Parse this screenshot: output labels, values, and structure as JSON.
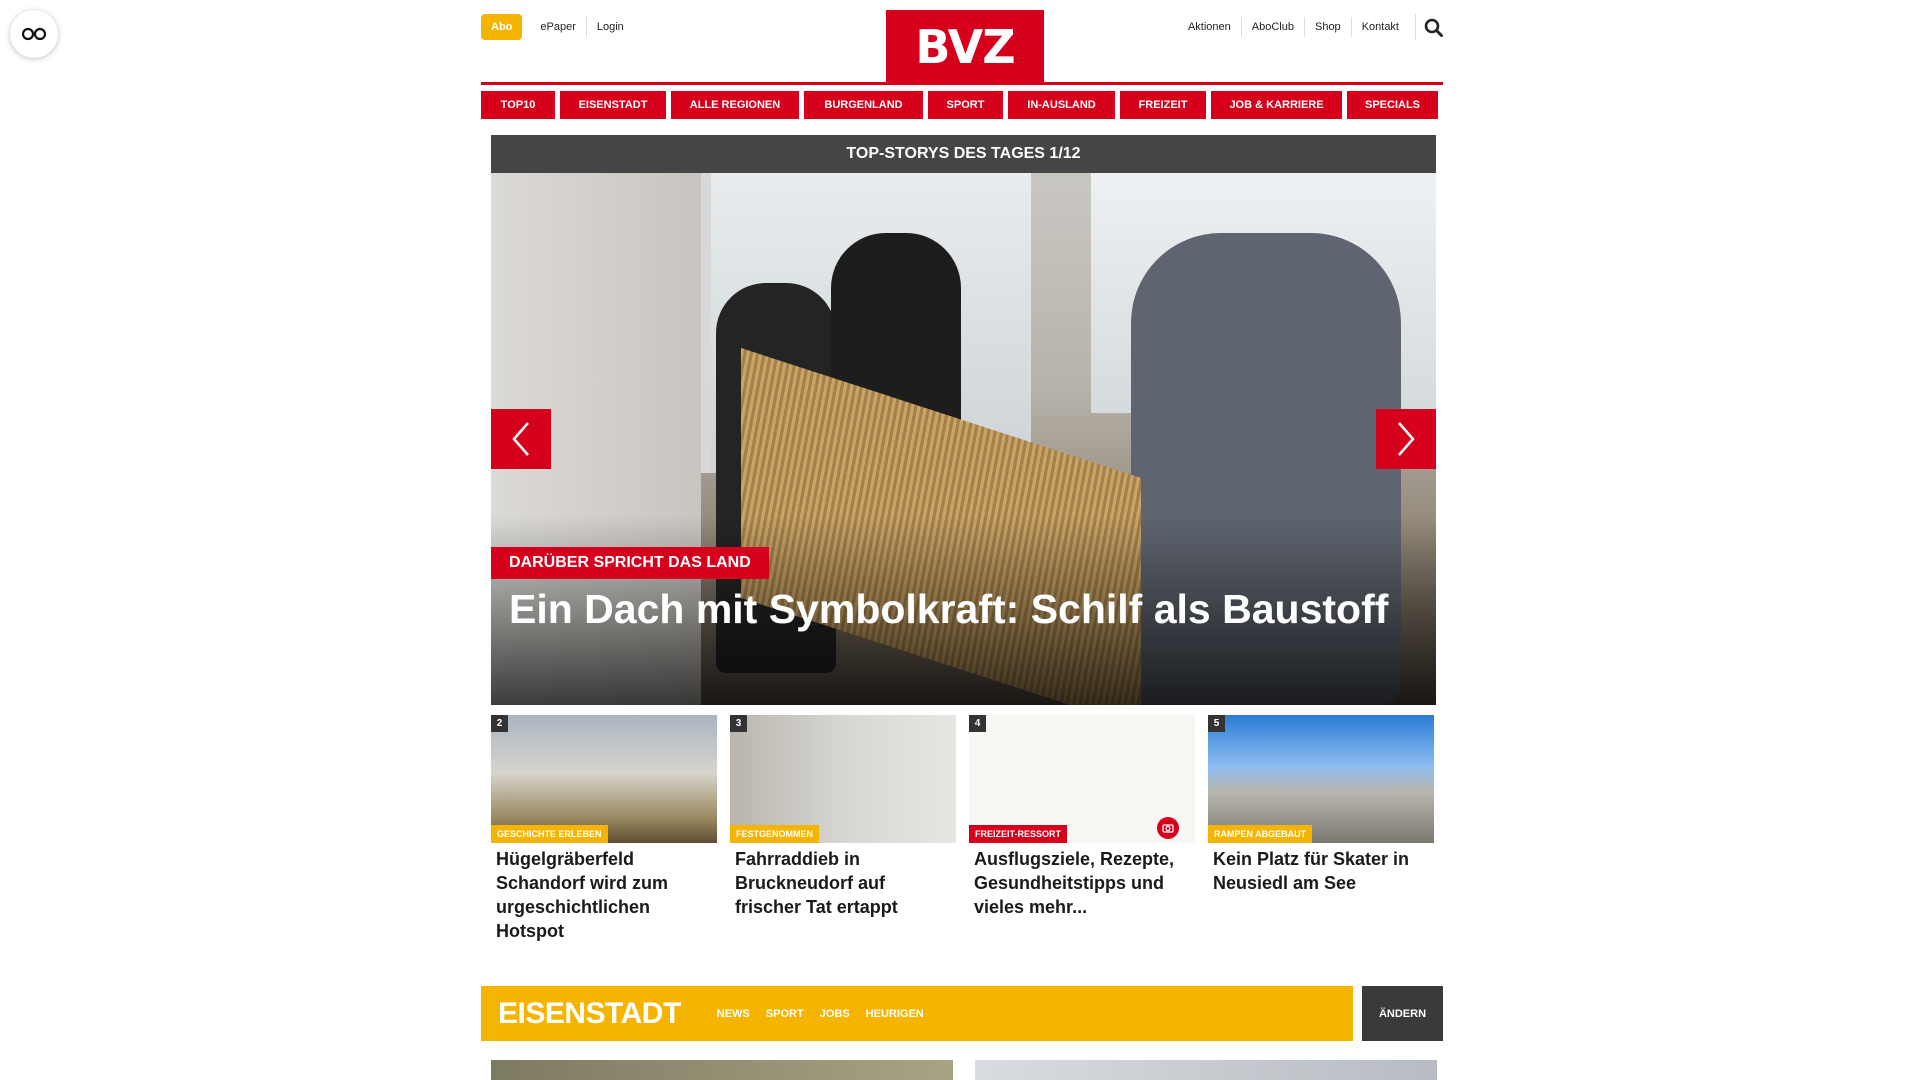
{
  "header": {
    "abo_label": "Abo",
    "epaper_label": "ePaper",
    "login_label": "Login",
    "logo_text": "BVZ",
    "right_links": [
      "Aktionen",
      "AboClub",
      "Shop",
      "Kontakt"
    ]
  },
  "nav": {
    "items": [
      "TOP10",
      "EISENSTADT",
      "ALLE REGIONEN",
      "BURGENLAND",
      "SPORT",
      "IN-AUSLAND",
      "FREIZEIT",
      "JOB & KARRIERE",
      "SPECIALS"
    ]
  },
  "stories": {
    "heading": "TOP-STORYS DES TAGES 1/12",
    "hero": {
      "kicker": "DARÜBER SPRICHT DAS LAND",
      "title": "Ein Dach mit Symbolkraft: Schilf als Baustoff"
    },
    "teasers": [
      {
        "num": "2",
        "kicker": "GESCHICHTE ERLEBEN",
        "title": "Hügelgräberfeld Schandorf wird zum urgeschichtlichen Hotspot",
        "kicker_color": "#f5b400"
      },
      {
        "num": "3",
        "kicker": "FESTGENOMMEN",
        "title": "Fahrraddieb in Bruckneudorf auf frischer Tat ertappt",
        "kicker_color": "#f5b400"
      },
      {
        "num": "4",
        "kicker": "FREIZEIT-RESSORT",
        "title": "Ausflugsziele, Rezepte, Gesundheitstipps und vieles mehr...",
        "kicker_color": "#d6001c"
      },
      {
        "num": "5",
        "kicker": "RAMPEN ABGEBAUT",
        "title": "Kein Platz für Skater in Neusiedl am See",
        "kicker_color": "#f5b400"
      }
    ]
  },
  "region": {
    "name": "EISENSTADT",
    "links": [
      "NEWS",
      "SPORT",
      "JOBS",
      "HEURIGEN"
    ],
    "change_label": "ÄNDERN"
  },
  "colors": {
    "brand_red": "#d6001c",
    "accent_yellow": "#f5b400",
    "dark_gray": "#454545"
  },
  "icons": {
    "reader": "glasses-icon",
    "search": "search-icon",
    "prev": "chevron-left-icon",
    "next": "chevron-right-icon",
    "gallery": "camera-icon"
  }
}
